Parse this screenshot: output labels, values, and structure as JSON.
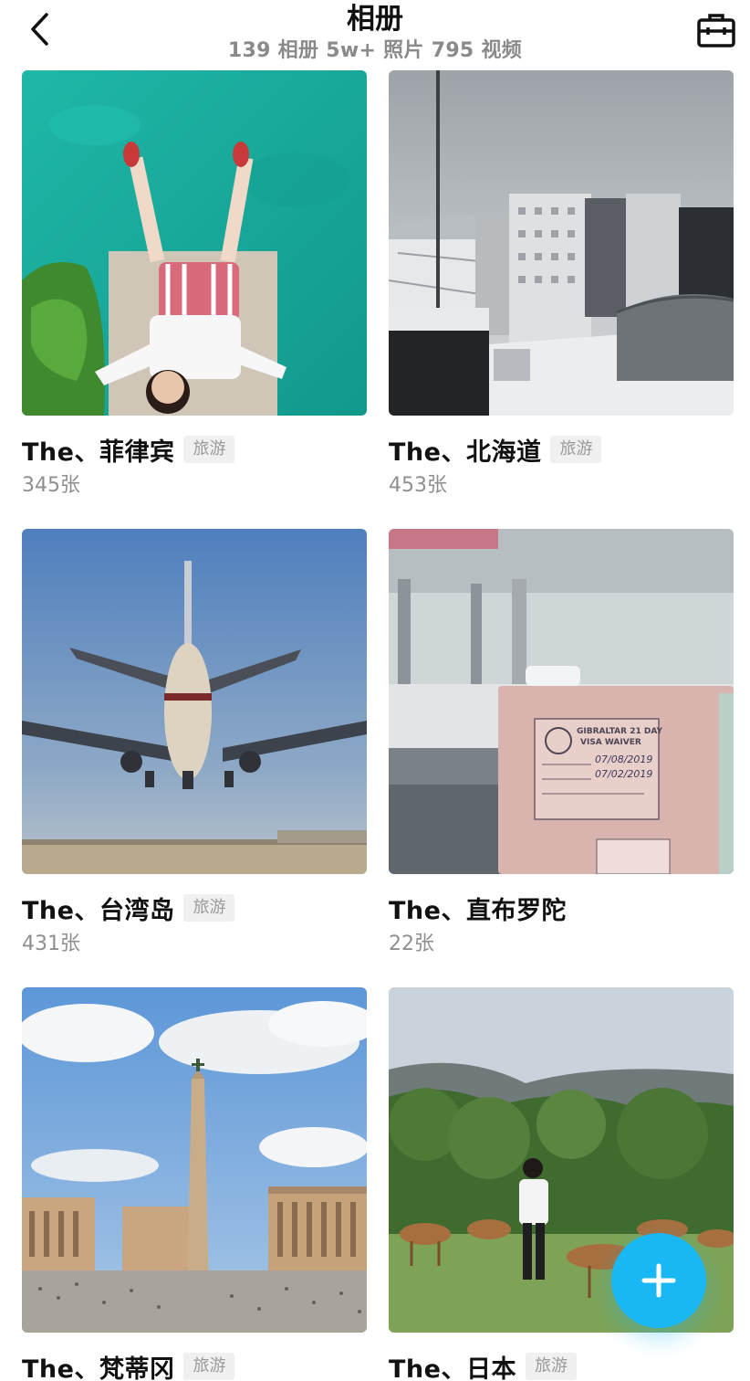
{
  "header": {
    "title": "相册",
    "subtitle": "139 相册 5w+ 照片 795 视频"
  },
  "albums": [
    {
      "name": "The、菲律宾",
      "tag": "旅游",
      "count": "345张"
    },
    {
      "name": "The、北海道",
      "tag": "旅游",
      "count": "453张"
    },
    {
      "name": "The、台湾岛",
      "tag": "旅游",
      "count": "431张"
    },
    {
      "name": "The、直布罗陀",
      "tag": "",
      "count": "22张"
    },
    {
      "name": "The、梵蒂冈",
      "tag": "旅游",
      "count": ""
    },
    {
      "name": "The、日本",
      "tag": "旅游",
      "count": ""
    }
  ],
  "photo_text": {
    "visa_title": "GIBRALTAR 21 DAY",
    "visa_sub": "VISA WAIVER",
    "date_issue": "07/08/2019",
    "date_expiry": "07/02/2019"
  },
  "colors": {
    "accent": "#19b8f5",
    "tag_bg": "#f0f0f0",
    "muted_text": "#8f8f8f"
  },
  "icons": {
    "back": "chevron-left-icon",
    "toolbox": "toolbox-icon",
    "add": "plus-icon"
  }
}
